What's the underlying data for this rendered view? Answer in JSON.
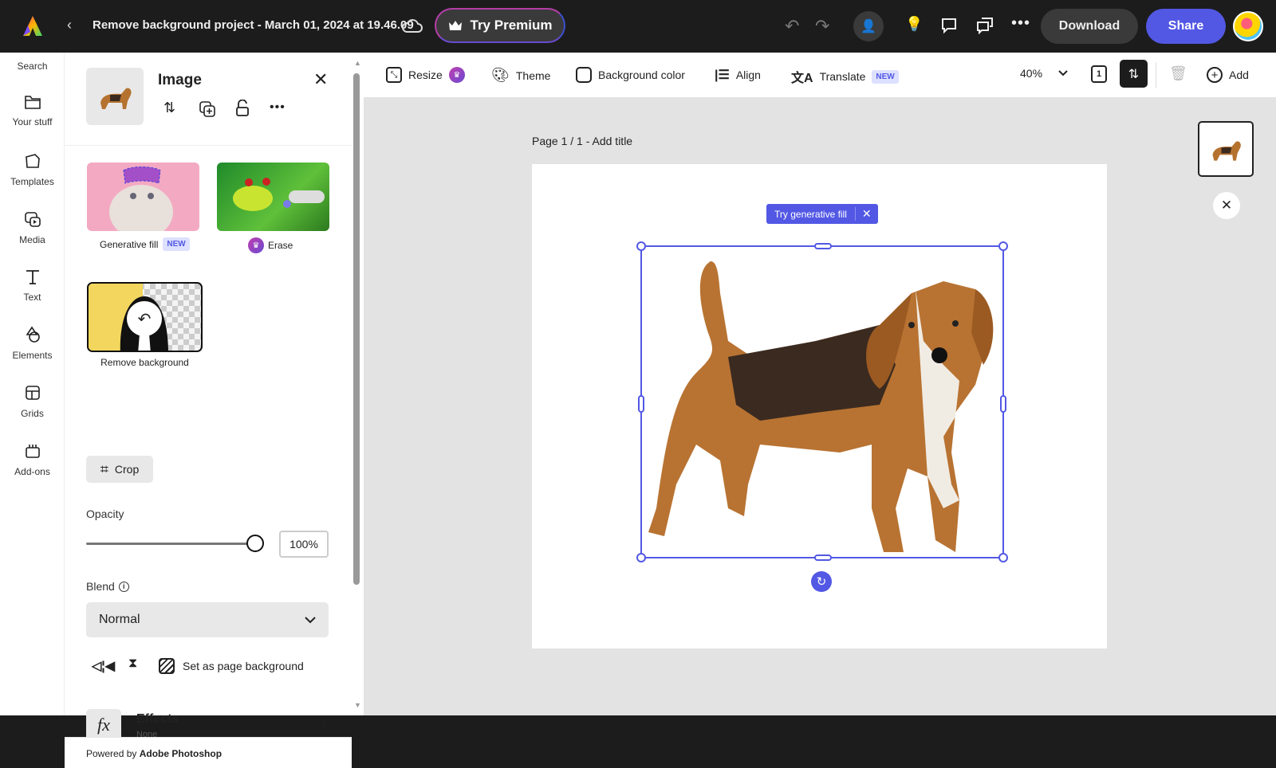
{
  "topbar": {
    "title": "Remove background project - March 01, 2024 at 19.46.09",
    "try_premium": "Try Premium",
    "download": "Download",
    "share": "Share",
    "icons": [
      "adobe-express-logo",
      "back-chevron-icon",
      "cloud-icon",
      "crown-icon",
      "undo-icon",
      "redo-icon",
      "invite-user-icon",
      "lightbulb-icon",
      "comment-icon",
      "chat-icon",
      "more-icon",
      "avatar"
    ]
  },
  "rail": {
    "search": "Search",
    "items": [
      {
        "label": "Your stuff",
        "icon": "folder-icon"
      },
      {
        "label": "Templates",
        "icon": "templates-icon"
      },
      {
        "label": "Media",
        "icon": "media-icon"
      },
      {
        "label": "Text",
        "icon": "text-icon"
      },
      {
        "label": "Elements",
        "icon": "elements-icon"
      },
      {
        "label": "Grids",
        "icon": "grids-icon"
      },
      {
        "label": "Add-ons",
        "icon": "addons-icon"
      }
    ]
  },
  "panel": {
    "title": "Image",
    "tools": [
      {
        "label": "Generative fill",
        "badge": "NEW"
      },
      {
        "label": "Erase",
        "premium": true
      },
      {
        "label": "Remove background",
        "selected": true
      }
    ],
    "crop": "Crop",
    "opacity_label": "Opacity",
    "opacity_value": "100%",
    "opacity_fraction": 1.0,
    "blend_label": "Blend",
    "blend_value": "Normal",
    "set_bg": "Set as page background",
    "effects_title": "Effects",
    "effects_value": "None",
    "powered_prefix": "Powered by ",
    "powered_brand": "Adobe Photoshop"
  },
  "toolbar": {
    "resize": "Resize",
    "theme": "Theme",
    "bg_color": "Background color",
    "align": "Align",
    "translate": "Translate",
    "translate_badge": "NEW",
    "zoom": "40%",
    "pages_count": "1",
    "add": "Add"
  },
  "canvas": {
    "page_label": "Page 1 / 1 - ",
    "add_title": "Add title",
    "gen_fill_chip": "Try generative fill"
  },
  "colors": {
    "accent": "#5258e4",
    "topbar": "#1c1c1c",
    "canvas": "#e3e3e3",
    "premium": "#b43ea8"
  }
}
